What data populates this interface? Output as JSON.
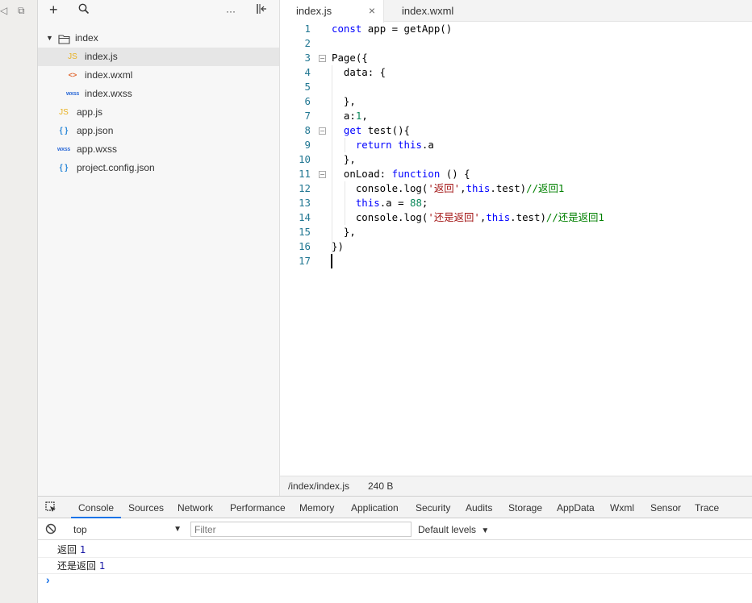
{
  "tree": {
    "items": [
      {
        "label": "index",
        "type": "folder",
        "icon": "folder-icon"
      },
      {
        "label": "index.js",
        "type": "js",
        "icon_text": "JS"
      },
      {
        "label": "index.wxml",
        "type": "wxml",
        "icon_text": "<>"
      },
      {
        "label": "index.wxss",
        "type": "wxss",
        "icon_text": "wxss"
      },
      {
        "label": "app.js",
        "type": "js",
        "icon_text": "JS"
      },
      {
        "label": "app.json",
        "type": "json",
        "icon_text": "{ }"
      },
      {
        "label": "app.wxss",
        "type": "wxss",
        "icon_text": "wxss"
      },
      {
        "label": "project.config.json",
        "type": "json",
        "icon_text": "{ }"
      }
    ],
    "toolbar": {
      "add": "+",
      "more": "···"
    }
  },
  "editor": {
    "tabs": [
      {
        "label": "index.js",
        "active": true
      },
      {
        "label": "index.wxml",
        "active": false
      }
    ],
    "close_glyph": "×",
    "line_numbers": [
      "1",
      "2",
      "3",
      "4",
      "5",
      "6",
      "7",
      "8",
      "9",
      "10",
      "11",
      "12",
      "13",
      "14",
      "15",
      "16",
      "17"
    ],
    "status": {
      "path": "/index/index.js",
      "size": "240 B"
    }
  },
  "devtools": {
    "tabs": [
      "Console",
      "Sources",
      "Network",
      "Performance",
      "Memory",
      "Application",
      "Security",
      "Audits",
      "Storage",
      "AppData",
      "Wxml",
      "Sensor",
      "Trace"
    ],
    "active_tab": "Console",
    "context": "top",
    "filter_placeholder": "Filter",
    "levels": "Default levels",
    "logs": [
      {
        "text": "返回",
        "value": "1"
      },
      {
        "text": "还是返回",
        "value": "1"
      }
    ],
    "prompt": "›"
  },
  "colors": {
    "keyword": "#0000ff",
    "string": "#a31515",
    "number": "#09885a",
    "comment": "#008000",
    "accent": "#1a73e8"
  }
}
